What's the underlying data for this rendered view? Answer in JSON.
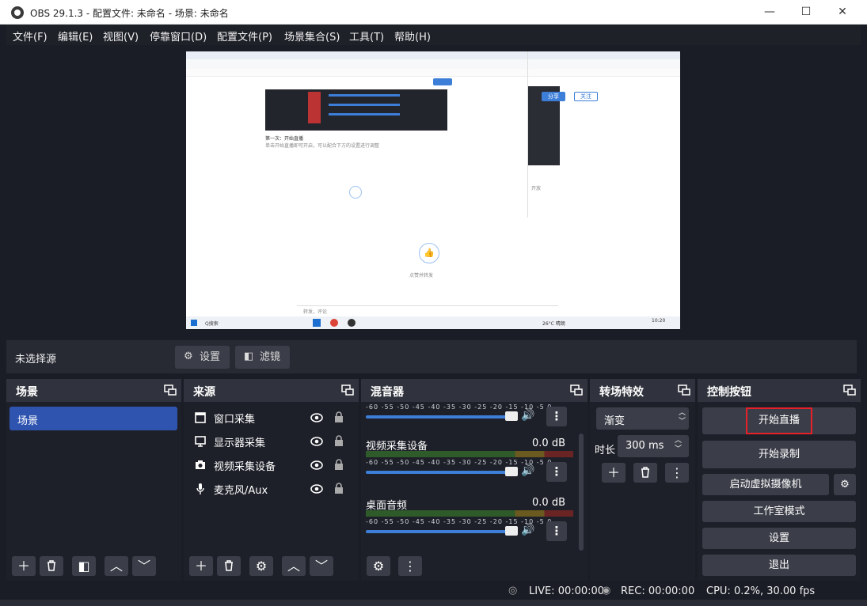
{
  "window": {
    "title": "OBS 29.1.3 - 配置文件: 未命名 - 场景: 未命名",
    "minimize": "—",
    "maximize": "☐",
    "close": "✕"
  },
  "menu": [
    "文件(F)",
    "编辑(E)",
    "视图(V)",
    "停靠窗口(D)",
    "配置文件(P)",
    "场景集合(S)",
    "工具(T)",
    "帮助(H)"
  ],
  "preview": {
    "inner_texts": [
      "第一次：开始直播",
      "单击开始直播即可开启，可以配合下方的设置进行调整",
      "点赞并转发",
      "转发，评论",
      "Q搜索",
      "开放"
    ],
    "share_button": "分享",
    "follow_button": "关注",
    "taskbar_time": "10:20",
    "weather": "26°C 晴朗"
  },
  "source_toolbar": {
    "no_source": "未选择源",
    "settings": "设置",
    "filters": "滤镜"
  },
  "docks": {
    "scenes": {
      "title": "场景",
      "items": [
        "场景"
      ]
    },
    "sources": {
      "title": "来源",
      "items": [
        {
          "name": "窗口采集",
          "icon": "window-icon"
        },
        {
          "name": "显示器采集",
          "icon": "monitor-icon"
        },
        {
          "name": "视频采集设备",
          "icon": "camera-icon"
        },
        {
          "name": "麦克风/Aux",
          "icon": "microphone-icon"
        }
      ]
    },
    "mixer": {
      "title": "混音器",
      "ticks": "-60 -55 -50 -45 -40 -35 -30 -25 -20 -15 -10 -5 0",
      "channels": [
        {
          "name": "",
          "db": "",
          "level": 0.93
        },
        {
          "name": "视频采集设备",
          "db": "0.0 dB",
          "level": 0.93
        },
        {
          "name": "桌面音频",
          "db": "0.0 dB",
          "level": 0.93
        }
      ]
    },
    "transitions": {
      "title": "转场特效",
      "type": "渐变",
      "duration_label": "时长",
      "duration_value": "300 ms"
    },
    "controls": {
      "title": "控制按钮",
      "start_stream": "开始直播",
      "start_record": "开始录制",
      "virtual_cam": "启动虚拟摄像机",
      "studio_mode": "工作室模式",
      "settings": "设置",
      "exit": "退出"
    }
  },
  "status": {
    "live": "LIVE: 00:00:00",
    "rec": "REC: 00:00:00",
    "cpu": "CPU: 0.2%, 30.00 fps"
  },
  "colors": {
    "accent": "#3d7ed8",
    "highlight": "#e8202a",
    "panel": "#272a33"
  }
}
